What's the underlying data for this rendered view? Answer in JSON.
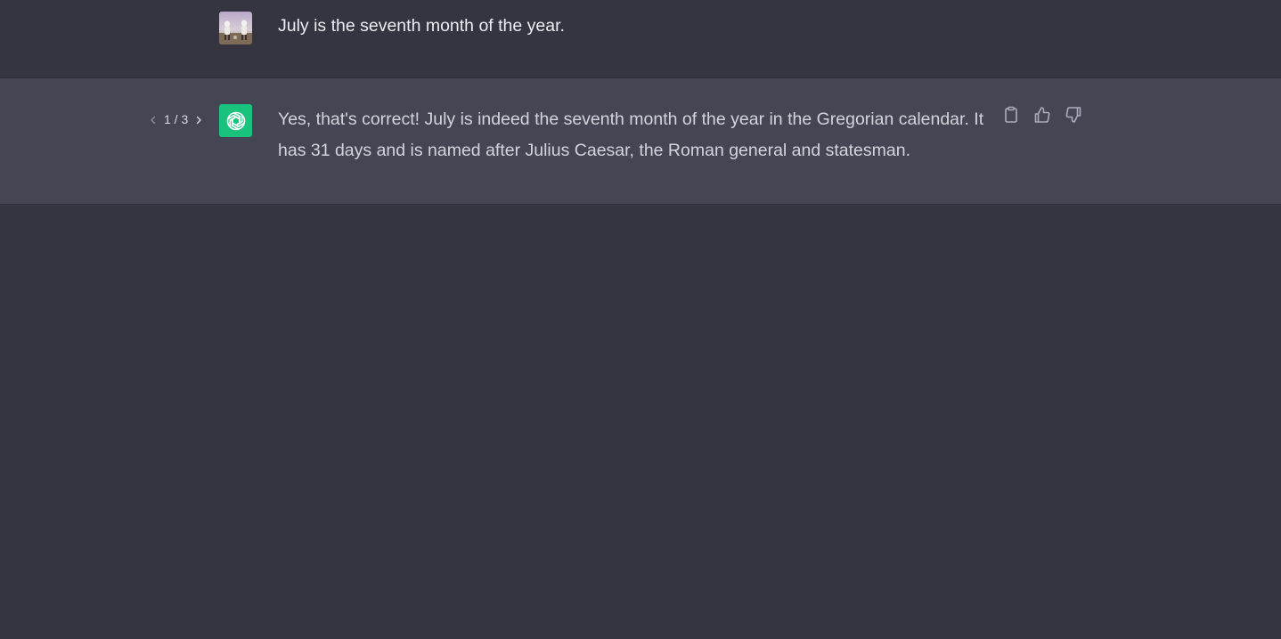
{
  "conversation": {
    "user_message": {
      "text": "July is the seventh month of the year.",
      "avatar_icon": "user-avatar-icon"
    },
    "assistant_message": {
      "text": "Yes, that's correct! July is indeed the seventh month of the year in the Gregorian calendar. It has 31 days and is named after Julius Caesar, the Roman general and statesman.",
      "avatar_icon": "openai-logo-icon",
      "pager": {
        "current": "1",
        "separator": "/",
        "total": "3",
        "label": "1 / 3"
      },
      "actions": [
        {
          "name": "copy",
          "icon": "clipboard-icon"
        },
        {
          "name": "thumbs-up",
          "icon": "thumbs-up-icon"
        },
        {
          "name": "thumbs-down",
          "icon": "thumbs-down-icon"
        }
      ]
    }
  },
  "colors": {
    "background": "#343541",
    "assistant_background": "#444654",
    "brand_green": "#19c37d",
    "text": "#ececf1"
  }
}
